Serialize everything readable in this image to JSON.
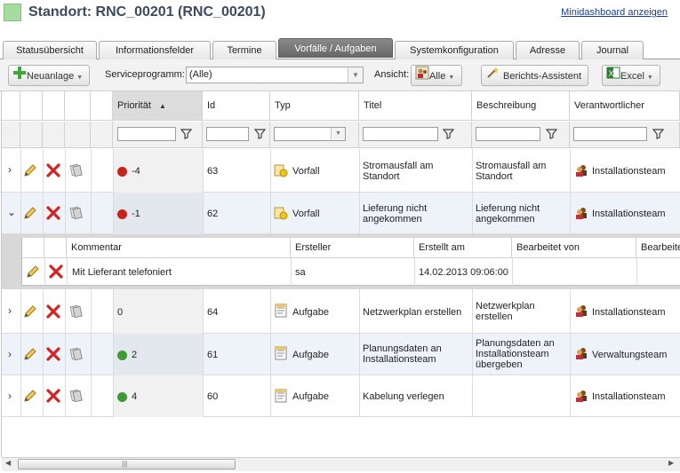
{
  "header": {
    "title": "Standort: RNC_00201 (RNC_00201)",
    "dashboard_link": "Minidashboard anzeigen",
    "accent_color": "#a7dca1"
  },
  "tabs": [
    {
      "label": "Statusübersicht",
      "active": false
    },
    {
      "label": "Informationsfelder",
      "active": false
    },
    {
      "label": "Termine",
      "active": false
    },
    {
      "label": "Vorfälle / Aufgaben",
      "active": true
    },
    {
      "label": "Systemkonfiguration",
      "active": false
    },
    {
      "label": "Adresse",
      "active": false
    },
    {
      "label": "Journal",
      "active": false
    }
  ],
  "toolbar": {
    "new_label": "Neuanlage",
    "serviceprogramm_label": "Serviceprogramm:",
    "serviceprogramm_value": "(Alle)",
    "ansicht_label": "Ansicht:",
    "ansicht_value": "Alle",
    "report_label": "Berichts-Assistent",
    "excel_label": "Excel"
  },
  "grid": {
    "columns": [
      "Priorität",
      "Id",
      "Typ",
      "Titel",
      "Beschreibung",
      "Verantwortlicher"
    ],
    "sorted_column": "Priorität",
    "rows": [
      {
        "priority": "-4",
        "status": "red",
        "id": "63",
        "type": "Vorfall",
        "title": "Stromausfall am Standort",
        "description": "Stromausfall am Standort",
        "owner": "Installationsteam",
        "expanded": false
      },
      {
        "priority": "-1",
        "status": "red",
        "id": "62",
        "type": "Vorfall",
        "title": "Lieferung nicht angekommen",
        "description": "Lieferung nicht angekommen",
        "owner": "Installationsteam",
        "expanded": true
      },
      {
        "priority": "0",
        "status": "none",
        "id": "64",
        "type": "Aufgabe",
        "title": "Netzwerkplan erstellen",
        "description": "Netzwerkplan erstellen",
        "owner": "Installationsteam",
        "expanded": false
      },
      {
        "priority": "2",
        "status": "green",
        "id": "61",
        "type": "Aufgabe",
        "title": "Planungsdaten an Installationsteam",
        "description": "Planungsdaten an Installationsteam übergeben",
        "owner": "Verwaltungsteam",
        "expanded": false
      },
      {
        "priority": "4",
        "status": "green",
        "id": "60",
        "type": "Aufgabe",
        "title": "Kabelung verlegen",
        "description": "",
        "owner": "Installationsteam",
        "expanded": false
      }
    ]
  },
  "detail": {
    "columns": [
      "Kommentar",
      "Ersteller",
      "Erstellt am",
      "Bearbeitet von",
      "Bearbeite"
    ],
    "rows": [
      {
        "comment": "Mit Lieferant telefoniert",
        "creator": "sa",
        "created_at": "14.02.2013 09:06:00",
        "edited_by": "",
        "edited": ""
      }
    ]
  },
  "colors": {
    "red": "#c8221b",
    "green": "#3f9a34",
    "tab_active": "#6f6f6f"
  }
}
